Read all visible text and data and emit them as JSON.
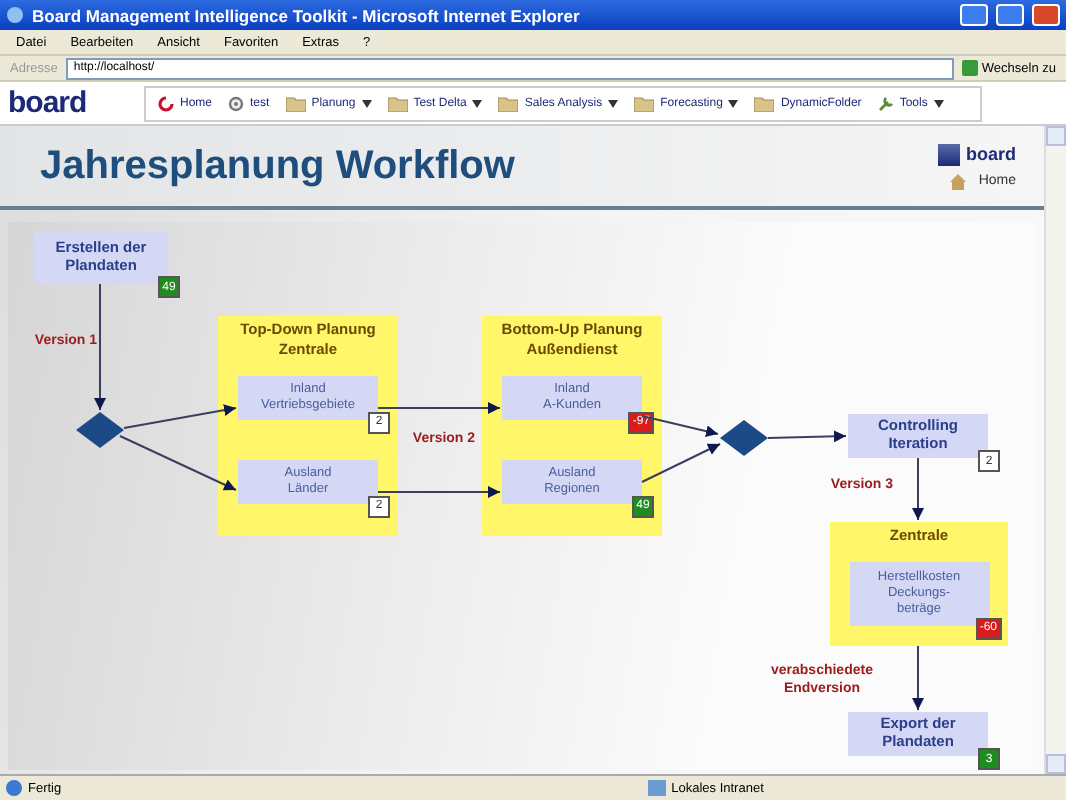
{
  "window": {
    "title": "Board Management Intelligence Toolkit - Microsoft Internet Explorer"
  },
  "menu": [
    "Datei",
    "Bearbeiten",
    "Ansicht",
    "Favoriten",
    "Extras",
    "?"
  ],
  "address_bar": {
    "label": "Adresse",
    "value": "http://localhost/",
    "go": "Wechseln zu"
  },
  "app_toolbar": {
    "logo": "board",
    "items": [
      {
        "label": "Home",
        "dropdown": false
      },
      {
        "label": "test",
        "dropdown": false
      },
      {
        "label": "Planung",
        "dropdown": true
      },
      {
        "label": "Test Delta",
        "dropdown": true
      },
      {
        "label": "Sales Analysis",
        "dropdown": true
      },
      {
        "label": "Forecasting",
        "dropdown": true
      },
      {
        "label": "DynamicFolder",
        "dropdown": false
      },
      {
        "label": "Tools",
        "dropdown": true
      }
    ]
  },
  "header": {
    "title": "Jahresplanung Workflow",
    "logo": "board",
    "home": "Home"
  },
  "workflow": [
    {
      "kind": "step",
      "label": "Erstellen der\nPlandaten",
      "badge": {
        "text": "49",
        "color": "#1e8c1e"
      }
    },
    {
      "kind": "label",
      "text": "Version 1"
    },
    {
      "kind": "decision"
    },
    {
      "kind": "group",
      "title": "Top-Down Planung\nZentrale",
      "steps": [
        {
          "label": "Inland\nVertriebsgebiete",
          "badge": {
            "text": "2",
            "color": "#ffffff"
          }
        },
        {
          "label": "Ausland\nLänder",
          "badge": {
            "text": "2",
            "color": "#ffffff"
          }
        }
      ]
    },
    {
      "kind": "label",
      "text": "Version 2"
    },
    {
      "kind": "group",
      "title": "Bottom-Up Planung\nAußendienst",
      "steps": [
        {
          "label": "Inland\nA-Kunden",
          "badge": {
            "text": "-97",
            "color": "#d81c1c"
          }
        },
        {
          "label": "Ausland\nRegionen",
          "badge": {
            "text": "49",
            "color": "#1e8c1e"
          }
        }
      ]
    },
    {
      "kind": "decision"
    },
    {
      "kind": "step",
      "label": "Controlling\nIteration",
      "badge": {
        "text": "2",
        "color": "#ffffff"
      }
    },
    {
      "kind": "label",
      "text": "Version 3"
    },
    {
      "kind": "group",
      "title": "Zentrale",
      "steps": [
        {
          "label": "Herstellkosten\nDeckungs-\nbeträge",
          "badge": {
            "text": "-60",
            "color": "#d81c1c"
          }
        }
      ]
    },
    {
      "kind": "label",
      "text": "verabschiedete\nEndversion"
    },
    {
      "kind": "step",
      "label": "Export der\nPlandaten",
      "badge": {
        "text": "3",
        "color": "#1e8c1e"
      }
    }
  ],
  "status_bar": {
    "text": "Fertig",
    "zone": "Lokales Intranet"
  }
}
